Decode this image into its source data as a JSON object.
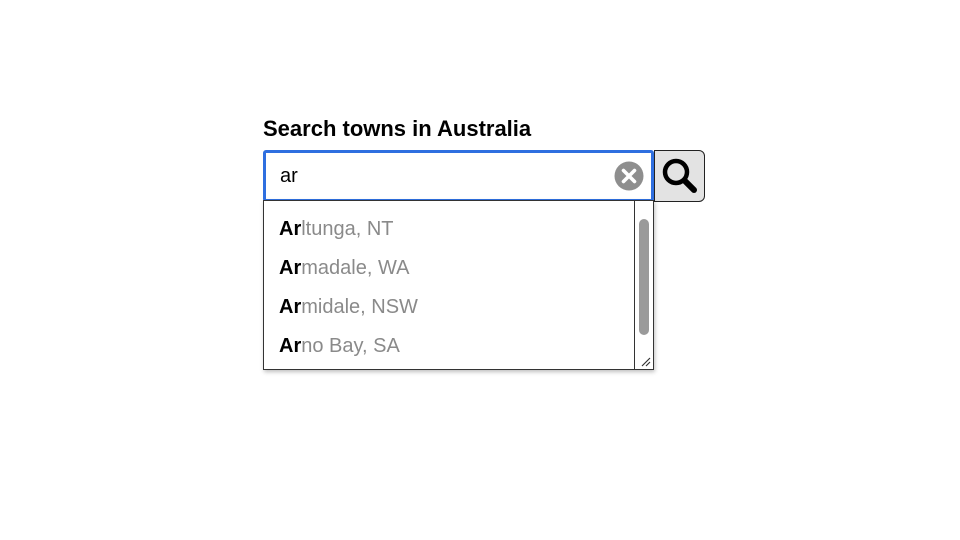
{
  "search": {
    "title": "Search towns in Australia",
    "value": "ar",
    "clear_icon": "clear-circle-x-icon",
    "search_icon": "magnifying-glass-icon"
  },
  "suggestions": [
    {
      "match": "Ar",
      "rest": "ltunga, NT"
    },
    {
      "match": "Ar",
      "rest": "madale, WA"
    },
    {
      "match": "Ar",
      "rest": "midale, NSW"
    },
    {
      "match": "Ar",
      "rest": "no Bay, SA"
    }
  ],
  "colors": {
    "focus_border": "#2f6fe0",
    "match_text": "#000000",
    "rest_text": "#8a8a8a",
    "button_bg": "#e3e3e3",
    "scroll_thumb": "#9a9a9a"
  }
}
